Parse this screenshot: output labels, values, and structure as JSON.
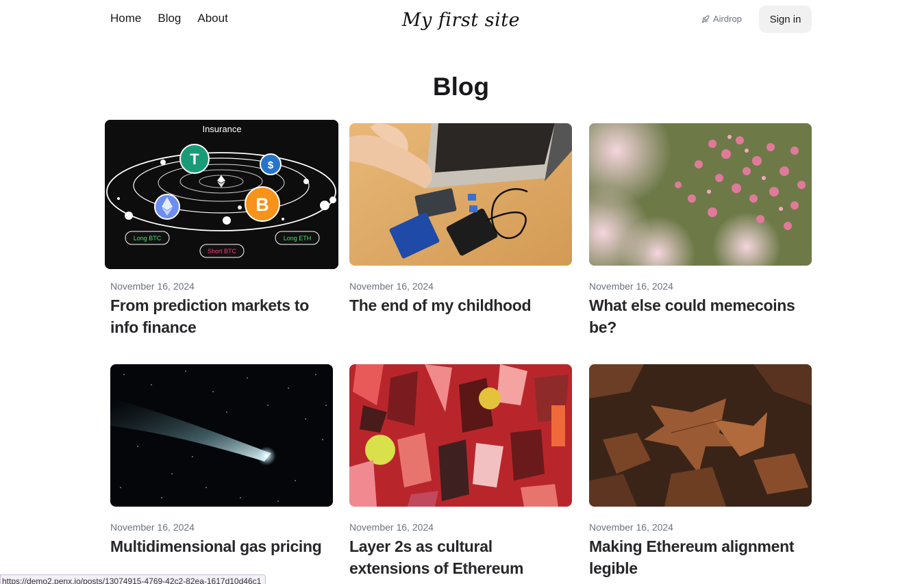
{
  "nav": {
    "links": [
      "Home",
      "Blog",
      "About"
    ],
    "site_title": "My first site",
    "airdrop_label": "Airdrop",
    "signin_label": "Sign in"
  },
  "page": {
    "heading": "Blog"
  },
  "posts": [
    {
      "date": "November 16, 2024",
      "title": "From prediction markets to info finance",
      "image": "crypto-insurance-orbit"
    },
    {
      "date": "November 16, 2024",
      "title": "The end of my childhood",
      "image": "laptop-on-desk"
    },
    {
      "date": "November 16, 2024",
      "title": "What else could memecoins be?",
      "image": "pink-flowers"
    },
    {
      "date": "November 16, 2024",
      "title": "Multidimensional gas pricing",
      "image": "comet-in-space"
    },
    {
      "date": "November 16, 2024",
      "title": "Layer 2s as cultural extensions of Ethereum",
      "image": "colorful-shapes"
    },
    {
      "date": "November 16, 2024",
      "title": "Making Ethereum alignment legible",
      "image": "autumn-leaves"
    }
  ],
  "post0_image_text": {
    "heading": "Insurance",
    "long_btc": "Long BTC",
    "short_btc": "Short BTC",
    "long_eth": "Long ETH"
  },
  "status_url": "https://demo2.penx.io/posts/13074915-4769-42c2-82ea-1617d10d46c1"
}
